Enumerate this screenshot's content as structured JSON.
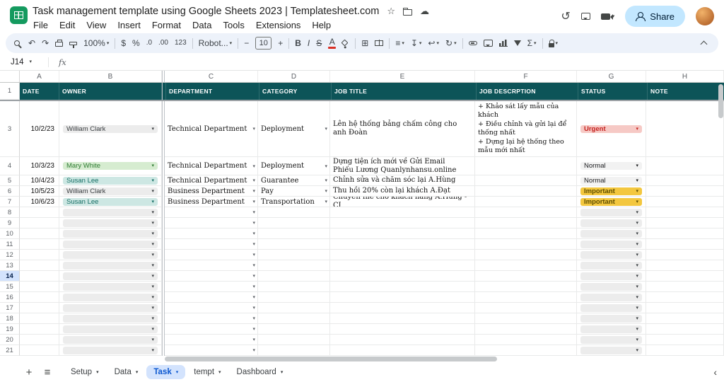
{
  "titlebar": {
    "title": "Task management template using Google Sheets 2023 | Templatesheet.com",
    "star_icon": "☆",
    "cloud_icon": "☁",
    "history_icon": "↺",
    "share_label": "Share"
  },
  "menubar": {
    "items": [
      "File",
      "Edit",
      "View",
      "Insert",
      "Format",
      "Data",
      "Tools",
      "Extensions",
      "Help"
    ]
  },
  "toolbar": {
    "items": [
      {
        "name": "search-icon",
        "kind": "css",
        "cls": "search"
      },
      {
        "name": "undo-icon",
        "kind": "glyph",
        "glyph": "↶"
      },
      {
        "name": "redo-icon",
        "kind": "glyph",
        "glyph": "↷"
      },
      {
        "name": "print-icon",
        "kind": "css",
        "cls": "print"
      },
      {
        "name": "paint-format-icon",
        "kind": "css",
        "cls": "paint"
      },
      {
        "name": "zoom-select",
        "kind": "text",
        "text": "100%",
        "dropdown": true
      },
      {
        "name": "divider"
      },
      {
        "name": "currency-format-icon",
        "kind": "glyph",
        "glyph": "$"
      },
      {
        "name": "percent-format-icon",
        "kind": "glyph",
        "glyph": "%"
      },
      {
        "name": "decrease-decimal-icon",
        "kind": "text",
        "text": ".0",
        "small": true
      },
      {
        "name": "increase-decimal-icon",
        "kind": "text",
        "text": ".00",
        "small": true
      },
      {
        "name": "more-formats-icon",
        "kind": "text",
        "text": "123",
        "small": true
      },
      {
        "name": "divider"
      },
      {
        "name": "font-select",
        "kind": "text",
        "text": "Robot...",
        "dropdown": true
      },
      {
        "name": "divider"
      },
      {
        "name": "decrease-font-size-icon",
        "kind": "glyph",
        "glyph": "−"
      },
      {
        "name": "font-size-input",
        "kind": "box",
        "text": "10"
      },
      {
        "name": "increase-font-size-icon",
        "kind": "glyph",
        "glyph": "+"
      },
      {
        "name": "divider"
      },
      {
        "name": "bold-icon",
        "kind": "text",
        "text": "B",
        "bold": true
      },
      {
        "name": "italic-icon",
        "kind": "text",
        "text": "I",
        "italic": true
      },
      {
        "name": "strikethrough-icon",
        "kind": "text",
        "text": "S",
        "strike": true
      },
      {
        "name": "text-color-icon",
        "kind": "text",
        "text": "A",
        "underbar": "#d93025"
      },
      {
        "name": "fill-color-icon",
        "kind": "css",
        "cls": "fill"
      },
      {
        "name": "divider"
      },
      {
        "name": "borders-icon",
        "kind": "glyph",
        "glyph": "⊞"
      },
      {
        "name": "merge-cells-icon",
        "kind": "css",
        "cls": "merge"
      },
      {
        "name": "divider"
      },
      {
        "name": "horizontal-align-icon",
        "kind": "glyph",
        "glyph": "≡",
        "dropdown": true
      },
      {
        "name": "vertical-align-icon",
        "kind": "glyph",
        "glyph": "↧",
        "dropdown": true
      },
      {
        "name": "text-wrap-icon",
        "kind": "glyph",
        "glyph": "↩",
        "dropdown": true
      },
      {
        "name": "text-rotate-icon",
        "kind": "glyph",
        "glyph": "↻",
        "dropdown": true
      },
      {
        "name": "divider"
      },
      {
        "name": "insert-link-icon",
        "kind": "css",
        "cls": "link"
      },
      {
        "name": "insert-comment-icon",
        "kind": "css",
        "cls": "bubble"
      },
      {
        "name": "insert-chart-icon",
        "kind": "css",
        "cls": "chart"
      },
      {
        "name": "filter-icon",
        "kind": "css",
        "cls": "filter"
      },
      {
        "name": "functions-icon",
        "kind": "glyph",
        "glyph": "Σ",
        "dropdown": true
      },
      {
        "name": "divider"
      },
      {
        "name": "protect-range-icon",
        "kind": "css",
        "cls": "lock",
        "dropdown": true
      }
    ]
  },
  "formula_bar": {
    "cell_ref": "J14",
    "fx_label": "fx"
  },
  "grid": {
    "column_letters": [
      "A",
      "B",
      "C",
      "D",
      "E",
      "F",
      "G",
      "H"
    ],
    "header_row": {
      "number": "1",
      "cells": [
        "DATE",
        "OWNER",
        "DEPARTMENT",
        "CATEGORY",
        "JOB TITLE",
        "JOB DESCRPTION",
        "STATUS",
        "NOTE"
      ]
    },
    "data_rows": [
      {
        "number": "3",
        "date": "10/2/23",
        "owner": "William Clark",
        "owner_color": "gray",
        "department": "Technical Department",
        "category": "Deployment",
        "job_title": "Lên hệ thống bảng chấm công cho anh Đoàn",
        "job_description": "+ Khảo sát lấy mẫu của khách\n+ Điều chỉnh và gửi lại để thống nhất\n+ Dựng lại hệ thống theo mẫu mới nhất",
        "status": "Urgent",
        "status_color": "urgent",
        "note": ""
      },
      {
        "number": "4",
        "date": "10/3/23",
        "owner": "Mary White",
        "owner_color": "green",
        "department": "Technical Department",
        "category": "Deployment",
        "job_title": "Dựng tiện ích mới về Gửi Email Phiếu Lương Quanlynhansu.online",
        "job_description": "",
        "status": "Normal",
        "status_color": "normal",
        "note": ""
      },
      {
        "number": "5",
        "date": "10/4/23",
        "owner": "Susan Lee",
        "owner_color": "teal",
        "department": "Technical Department",
        "category": "Guarantee",
        "job_title": "Chỉnh sửa và chăm sóc lại A.Hùng",
        "job_description": "",
        "status": "Normal",
        "status_color": "normal",
        "note": ""
      },
      {
        "number": "6",
        "date": "10/5/23",
        "owner": "William Clark",
        "owner_color": "gray",
        "department": "Business Department",
        "category": "Pay",
        "job_title": "Thu hồi 20% còn lại khách A.Đạt",
        "job_description": "",
        "status": "Important",
        "status_color": "important",
        "note": ""
      },
      {
        "number": "7",
        "date": "10/6/23",
        "owner": "Susan Lee",
        "owner_color": "teal",
        "department": "Business Department",
        "category": "Transportation",
        "job_title": "Chuyển file cho khách hàng A.Hưng - CI",
        "job_description": "",
        "status": "Important",
        "status_color": "important",
        "note": ""
      }
    ],
    "empty_rows": [
      "8",
      "9",
      "10",
      "11",
      "12",
      "13",
      "14",
      "15",
      "16",
      "17",
      "18",
      "19",
      "20",
      "21"
    ],
    "selected_row": "14"
  },
  "sheet_tabs": {
    "tabs": [
      {
        "label": "Setup",
        "active": false
      },
      {
        "label": "Data",
        "active": false
      },
      {
        "label": "Task",
        "active": true
      },
      {
        "label": "tempt",
        "active": false
      },
      {
        "label": "Dashboard",
        "active": false
      }
    ]
  },
  "colors": {
    "header_bg": "#0d5458",
    "header_text": "#ffffff",
    "urgent_bg": "#f6c9c5",
    "urgent_text": "#c5221f",
    "important_bg": "#f3c73f",
    "important_text": "#5f4e00",
    "normal_bg": "#f2f2f2",
    "normal_text": "#202124",
    "owner_gray_bg": "#ececec",
    "owner_gray_text": "#3c4043",
    "owner_green_bg": "#d6ecd0",
    "owner_green_text": "#2f7d33",
    "owner_teal_bg": "#cde7e3",
    "owner_teal_text": "#156e64",
    "share_bg": "#c2e7ff",
    "share_text": "#001d35",
    "active_tab_bg": "#d3e3fd",
    "active_tab_text": "#0b57d0",
    "toolbar_bg": "#edf2fa",
    "logo_green": "#149a5f",
    "selected_rownum_bg": "#d3e3fd"
  }
}
